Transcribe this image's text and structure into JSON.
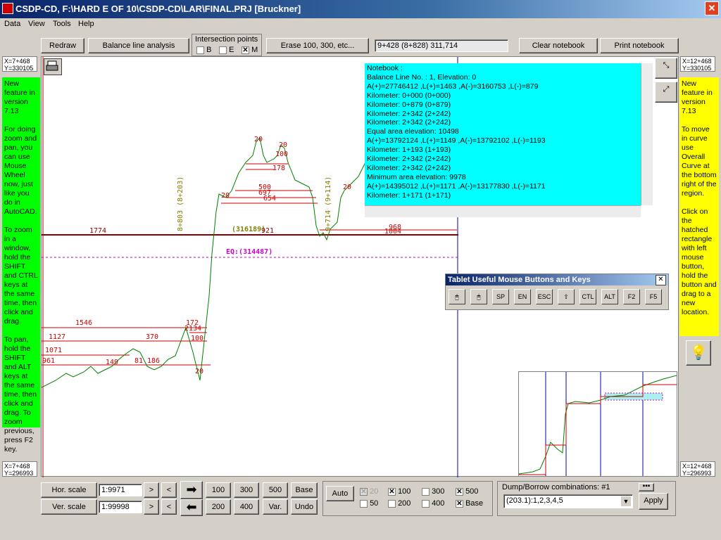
{
  "window": {
    "title": "CSDP-CD, F:\\HARD E OF 10\\CSDP-CD\\LAR\\FINAL.PRJ [Bruckner]"
  },
  "menu": [
    "Data",
    "View",
    "Tools",
    "Help"
  ],
  "toolbar": {
    "redraw": "Redraw",
    "balance": "Balance line analysis",
    "intersection_title": "Intersection points",
    "intersection_options": [
      {
        "label": "B",
        "checked": false
      },
      {
        "label": "E",
        "checked": false
      },
      {
        "label": "M",
        "checked": true
      }
    ],
    "erase": "Erase 100, 300, etc...",
    "station_readout": "9+428 (8+828)  311,714",
    "clear_notebook": "Clear notebook",
    "print_notebook": "Print notebook"
  },
  "coords": {
    "top_left": [
      "X=7+468",
      "Y=330105"
    ],
    "top_right": [
      "X=12+468",
      "Y=330105"
    ],
    "bottom_left": [
      "X=7+468",
      "Y=296993"
    ],
    "bottom_right": [
      "X=12+468",
      "Y=296993"
    ]
  },
  "left_panel": {
    "title": "New feature in version 7.13",
    "body1": "For doing zoom and pan, you can use Mouse Wheel now, just like you do in AutoCAD.",
    "body2": "To zoom in a window, hold the SHIFT and CTRL keys at the same time, then click and drag.",
    "body3": "To pan, hold the SHIFT and ALT keys at the same time, then click and drag. To zoom previous, press F2 key."
  },
  "right_panel": {
    "title": "New feature in version 7.13",
    "body1": "To move in curve use Overall Curve at the bottom right of the region.",
    "body2": "Click on the hatched rectangle with left mouse button, hold the button and drag to a new location."
  },
  "notebook": {
    "lines": [
      "Notebook :",
      "Balance Line No. : 1, Elevation: 0",
      "A(+)=27746412 ,L(+)=1463 ,A(-)=3160753 ,L(-)=879",
      "Kilometer: 0+000 (0+000)",
      "Kilometer: 0+879 (0+879)",
      "Kilometer: 2+342 (2+242)",
      "Kilometer: 2+342 (2+242)",
      "Equal area elevation: 10498",
      "A(+)=13792124 ,L(+)=1149 ,A(-)=13792102 ,L(-)=1193",
      "Kilometer: 1+193 (1+193)",
      "Kilometer: 2+342 (2+242)",
      "Kilometer: 2+342 (2+242)",
      "Minimum area elevation: 9978",
      "A(+)=14395012 ,L(+)=1171 ,A(-)=13177830 ,L(-)=1171",
      "Kilometer: 1+171 (1+171)"
    ]
  },
  "tablet": {
    "title": "Tablet Useful Mouse Buttons and Keys",
    "keys": [
      "",
      "",
      "SP",
      "EN",
      "ESC",
      "",
      "CTL",
      "ALT",
      "F2",
      "F5"
    ]
  },
  "chart_labels": {
    "l1774": "1774",
    "l316189": "(316189)",
    "l921": "921",
    "eq": "EQ:(314487)",
    "l968": "968",
    "l1004": "1004",
    "l1546": "1546",
    "l1127": "1127",
    "l1071": "1071",
    "l961": "961",
    "l370": "370",
    "l172": "172",
    "l2134": "2134",
    "l100a": "100",
    "l20a": "20",
    "l20b": "20",
    "l100b": "100",
    "l178": "178",
    "l500": "500",
    "l697": "697",
    "l654": "654",
    "l8803": "8+803 (8+203)",
    "l9714": "9+714 (9+114)",
    "l149": "149",
    "l81": "81",
    "l186": "186",
    "l20c": "20",
    "l20d": "20",
    "l20e": "20"
  },
  "bottom": {
    "hor_scale": "Hor. scale",
    "hor_value": "1:9971",
    "ver_scale": "Ver. scale",
    "ver_value": "1:99998",
    "gt": ">",
    "lt": "<",
    "b100": "100",
    "b300": "300",
    "b500": "500",
    "base": "Base",
    "b200": "200",
    "b400": "400",
    "var": "Var.",
    "undo": "Undo",
    "auto": "Auto",
    "checks": [
      {
        "label": "20",
        "checked": true,
        "disabled": true
      },
      {
        "label": "100",
        "checked": true
      },
      {
        "label": "300",
        "checked": false
      },
      {
        "label": "500",
        "checked": true
      },
      {
        "label": "50",
        "checked": false
      },
      {
        "label": "200",
        "checked": false
      },
      {
        "label": "400",
        "checked": false
      },
      {
        "label": "Base",
        "checked": true
      }
    ],
    "dump_title": "Dump/Borrow combinations: #1",
    "dump_value": "(203.1):1,2,3,4,5",
    "apply": "Apply"
  }
}
